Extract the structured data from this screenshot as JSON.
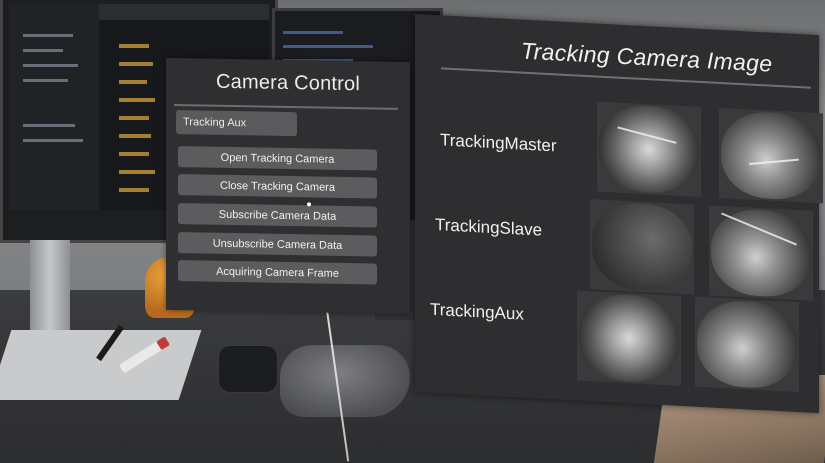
{
  "control_panel": {
    "title": "Camera Control",
    "camera_dropdown": {
      "selected": "Tracking Aux"
    },
    "buttons": [
      "Open Tracking Camera",
      "Close Tracking Camera",
      "Subscribe Camera Data",
      "Unsubscribe Camera Data",
      "Acquiring Camera Frame"
    ]
  },
  "image_panel": {
    "title": "Tracking Camera Image",
    "cameras": [
      {
        "label": "TrackingMaster"
      },
      {
        "label": "TrackingSlave"
      },
      {
        "label": "TrackingAux"
      }
    ]
  },
  "colors": {
    "panel_bg": "#2f2f31",
    "button_bg": "#5c5c5e",
    "text": "#f0f0f0"
  }
}
